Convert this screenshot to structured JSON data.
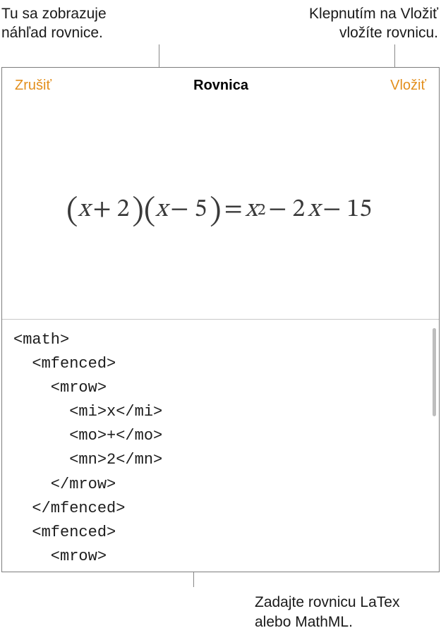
{
  "callouts": {
    "topLeft": "Tu sa zobrazuje náhľad rovnice.",
    "topRight": "Klepnutím na Vložiť vložíte rovnicu.",
    "bottom": "Zadajte rovnicu LaTex alebo MathML."
  },
  "toolbar": {
    "cancel": "Zrušiť",
    "title": "Rovnica",
    "insert": "Vložiť"
  },
  "preview": {
    "lparen1": "(",
    "x1": "x",
    "plus": "+",
    "two": "2",
    "rparen1": ")",
    "lparen2": "(",
    "x2": "x",
    "minus1": "−",
    "five": "5",
    "rparen2": ")",
    "eq": "=",
    "x3": "x",
    "sq": "2",
    "minus2": "−",
    "coef2": "2",
    "x4": "x",
    "minus3": "−",
    "fifteen": "15"
  },
  "editor": {
    "l1": "<math>",
    "l2": "  <mfenced>",
    "l3": "    <mrow>",
    "l4": "      <mi>x</mi>",
    "l5": "      <mo>+</mo>",
    "l6": "      <mn>2</mn>",
    "l7": "    </mrow>",
    "l8": "  </mfenced>",
    "l9": "  <mfenced>",
    "l10": "    <mrow>"
  }
}
